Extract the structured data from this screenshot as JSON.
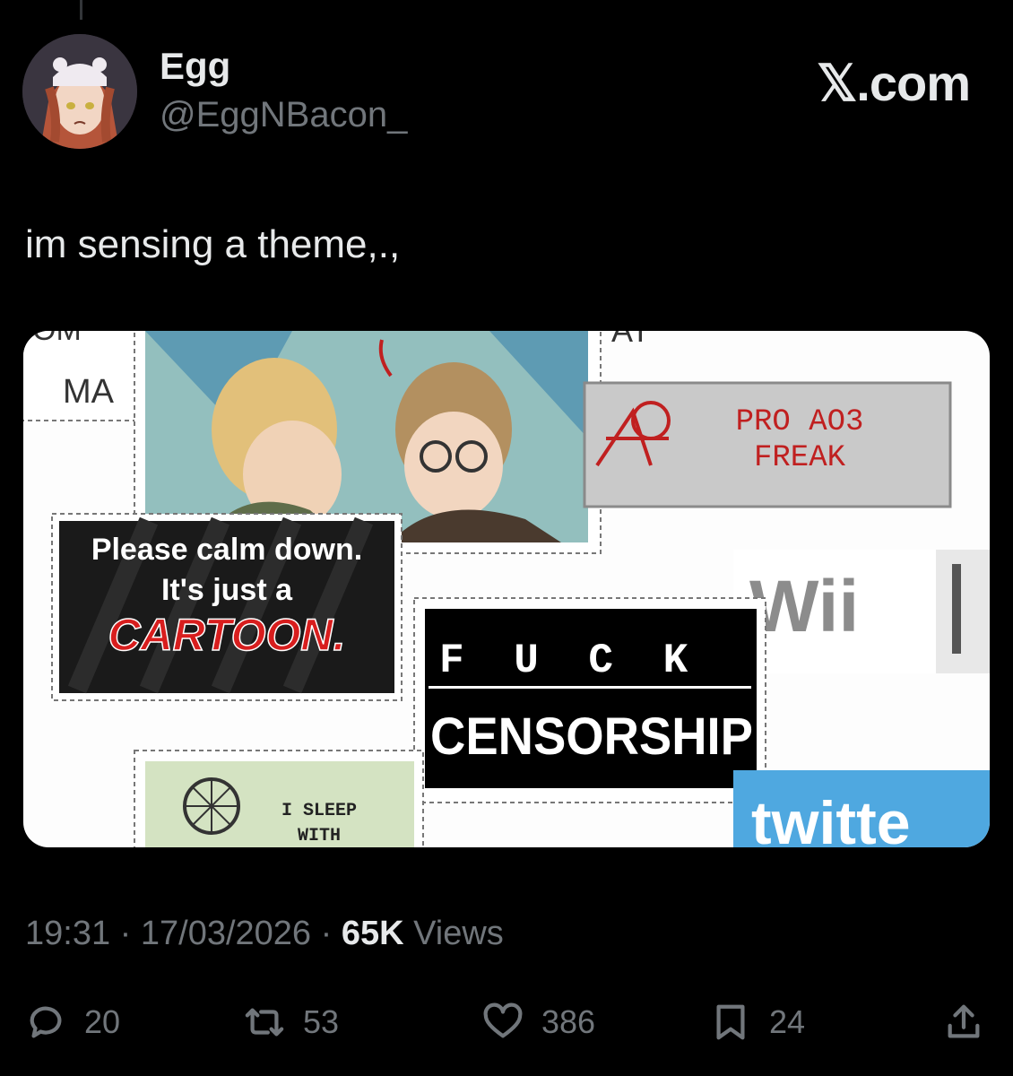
{
  "author": {
    "name": "Egg",
    "handle": "@EggNBacon_"
  },
  "brand": "𝕏.com",
  "tweet": {
    "text": "im sensing a theme,.,"
  },
  "media": {
    "stamps": {
      "top_left_partial": "MA",
      "top_partial": "AT",
      "calm_line1": "Please calm down.",
      "calm_line2": "It's just a",
      "calm_line3": "CARTOON.",
      "ao3_line1": "PRO AO3",
      "ao3_line2": "FREAK",
      "wii": "Wii",
      "fuck": "F U C K",
      "censorship": "CENSORSHIP",
      "sleep_line1": "I SLEEP",
      "sleep_line2": "WITH",
      "twitter_partial": "twitte"
    }
  },
  "meta": {
    "time": "19:31",
    "date": "17/03/2026",
    "views_count": "65K",
    "views_label": "Views"
  },
  "stats": {
    "replies": "20",
    "reposts": "53",
    "likes": "386",
    "bookmarks": "24"
  },
  "colors": {
    "background": "#000000",
    "text": "#e7e9ea",
    "muted": "#71767b"
  }
}
